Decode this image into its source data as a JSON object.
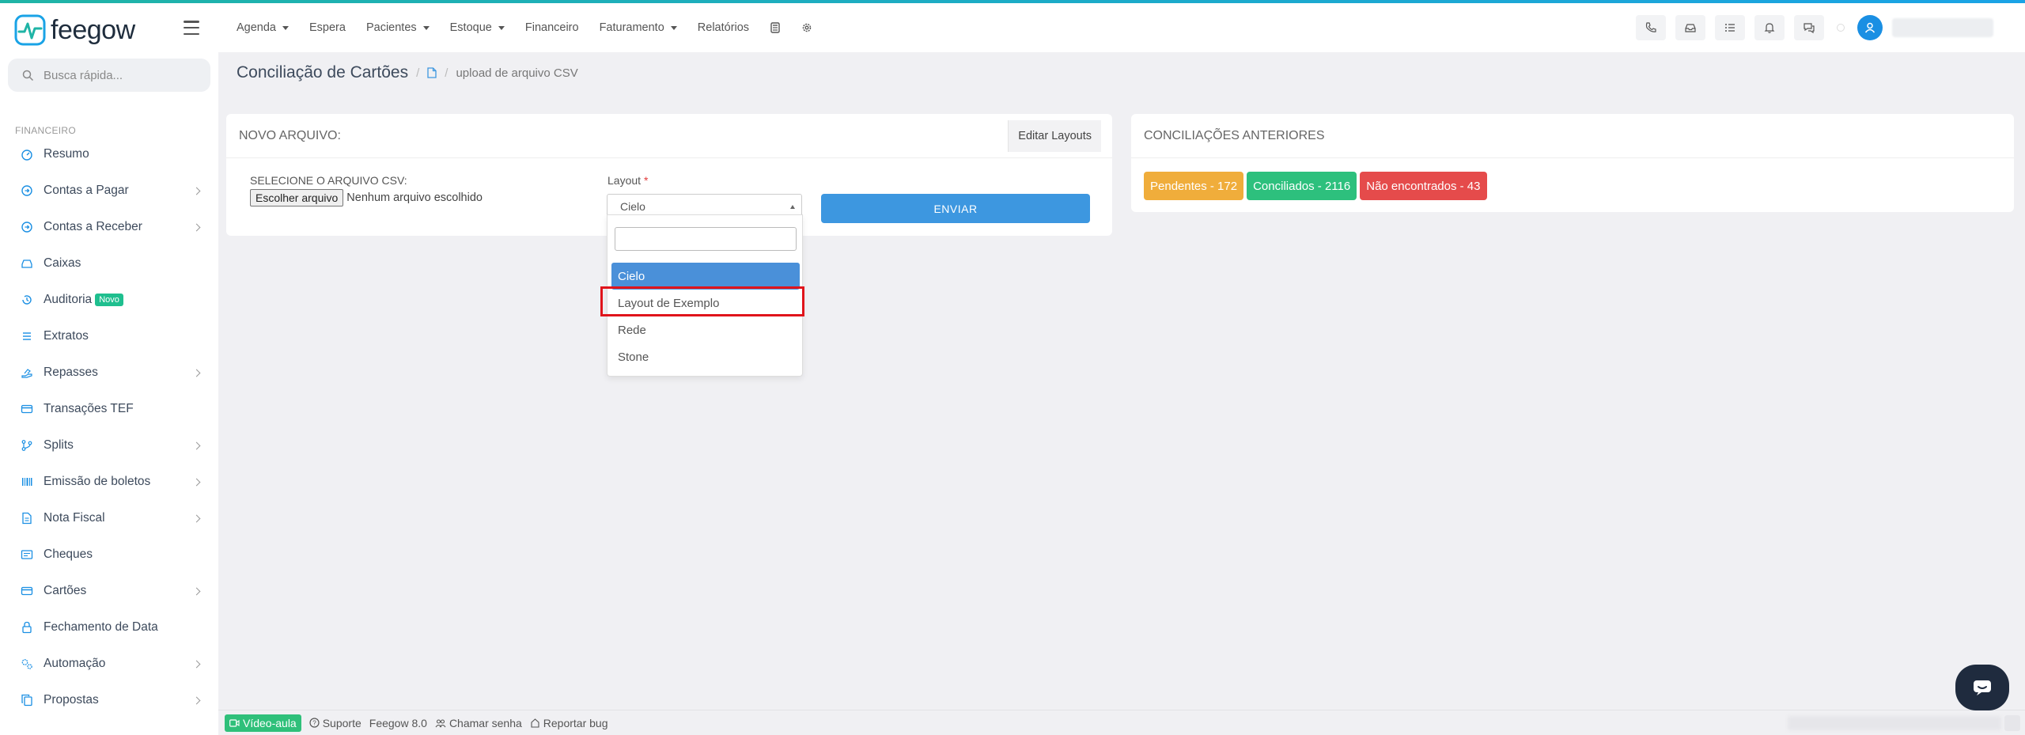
{
  "app": {
    "logo_text": "feegow"
  },
  "nav": {
    "items": [
      {
        "label": "Agenda",
        "dropdown": true
      },
      {
        "label": "Espera",
        "dropdown": false
      },
      {
        "label": "Pacientes",
        "dropdown": true
      },
      {
        "label": "Estoque",
        "dropdown": true
      },
      {
        "label": "Financeiro",
        "dropdown": false
      },
      {
        "label": "Faturamento",
        "dropdown": true
      },
      {
        "label": "Relatórios",
        "dropdown": false
      }
    ]
  },
  "sidebar": {
    "search_placeholder": "Busca rápida...",
    "section": "FINANCEIRO",
    "items": [
      {
        "label": "Resumo",
        "icon": "gauge-icon",
        "chevron": false
      },
      {
        "label": "Contas a Pagar",
        "icon": "arrow-circle-icon",
        "chevron": true
      },
      {
        "label": "Contas a Receber",
        "icon": "arrow-circle-icon",
        "chevron": true
      },
      {
        "label": "Caixas",
        "icon": "inbox-icon",
        "chevron": false
      },
      {
        "label": "Auditoria",
        "icon": "history-icon",
        "chevron": false,
        "badge": "Novo"
      },
      {
        "label": "Extratos",
        "icon": "list-icon",
        "chevron": false
      },
      {
        "label": "Repasses",
        "icon": "hand-icon",
        "chevron": true
      },
      {
        "label": "Transações TEF",
        "icon": "card-icon",
        "chevron": false
      },
      {
        "label": "Splits",
        "icon": "branch-icon",
        "chevron": true
      },
      {
        "label": "Emissão de boletos",
        "icon": "barcode-icon",
        "chevron": true
      },
      {
        "label": "Nota Fiscal",
        "icon": "document-icon",
        "chevron": true
      },
      {
        "label": "Cheques",
        "icon": "cheque-icon",
        "chevron": false
      },
      {
        "label": "Cartões",
        "icon": "card-icon",
        "chevron": true
      },
      {
        "label": "Fechamento de Data",
        "icon": "lock-icon",
        "chevron": false
      },
      {
        "label": "Automação",
        "icon": "gears-icon",
        "chevron": true
      },
      {
        "label": "Propostas",
        "icon": "copy-icon",
        "chevron": true
      }
    ]
  },
  "breadcrumb": {
    "title": "Conciliação de Cartões",
    "sep": "/",
    "current": "upload de arquivo CSV"
  },
  "novo_arquivo": {
    "heading": "NOVO ARQUIVO:",
    "edit_layouts": "Editar Layouts",
    "file_label": "SELECIONE O ARQUIVO CSV:",
    "file_button": "Escolher arquivo",
    "file_status": "Nenhum arquivo escolhido",
    "layout_label": "Layout",
    "layout_required": "*",
    "layout_value": "Cielo",
    "send_button": "ENVIAR"
  },
  "dropdown": {
    "options": [
      "Cielo",
      "Layout de Exemplo",
      "Rede",
      "Stone"
    ],
    "selected": "Cielo"
  },
  "conciliacoes": {
    "heading": "CONCILIAÇÕES ANTERIORES",
    "badges": [
      {
        "label": "Pendentes - 172",
        "color": "#f0ad3b"
      },
      {
        "label": "Conciliados - 2116",
        "color": "#2dc07d"
      },
      {
        "label": "Não encontrados - 43",
        "color": "#e54b4b"
      }
    ]
  },
  "footer": {
    "video": "Vídeo-aula",
    "suporte": "Suporte",
    "version": "Feegow 8.0",
    "chamar": "Chamar senha",
    "reportar": "Reportar bug"
  },
  "colors": {
    "primary": "#3d97e0",
    "accent": "#1fb4a6",
    "highlight": "#e0141b"
  }
}
